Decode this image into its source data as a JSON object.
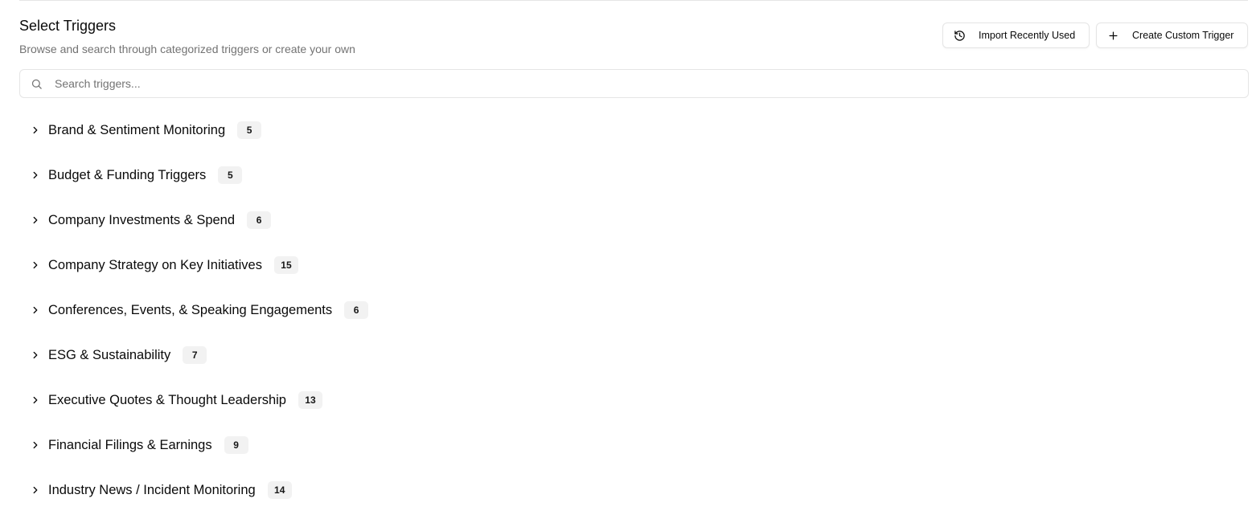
{
  "header": {
    "title": "Select Triggers",
    "subtitle": "Browse and search through categorized triggers or create your own"
  },
  "actions": {
    "import_label": "Import Recently Used",
    "import_icon": "history-icon",
    "create_label": "Create Custom Trigger",
    "create_icon": "plus-icon"
  },
  "search": {
    "placeholder": "Search triggers...",
    "value": "",
    "icon": "search-icon"
  },
  "categories": [
    {
      "label": "Brand & Sentiment Monitoring",
      "count": "5"
    },
    {
      "label": "Budget & Funding Triggers",
      "count": "5"
    },
    {
      "label": "Company Investments & Spend",
      "count": "6"
    },
    {
      "label": "Company Strategy on Key Initiatives",
      "count": "15"
    },
    {
      "label": "Conferences, Events, & Speaking Engagements",
      "count": "6"
    },
    {
      "label": "ESG & Sustainability",
      "count": "7"
    },
    {
      "label": "Executive Quotes & Thought Leadership",
      "count": "13"
    },
    {
      "label": "Financial Filings & Earnings",
      "count": "9"
    },
    {
      "label": "Industry News / Incident Monitoring",
      "count": "14"
    }
  ],
  "colors": {
    "text": "#0a0a0a",
    "muted": "#737373",
    "border": "#e5e5e5",
    "badge_bg": "#f2f2f2"
  }
}
